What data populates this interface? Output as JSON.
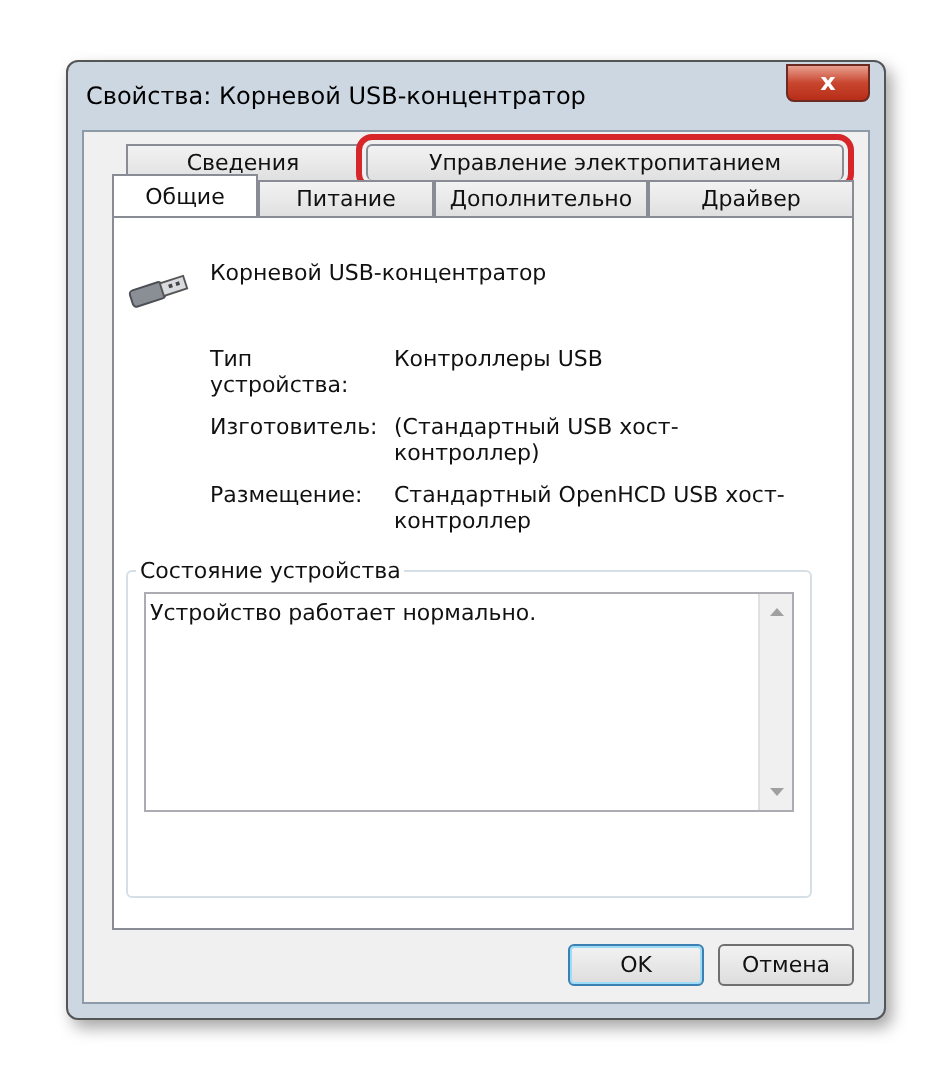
{
  "window": {
    "title": "Свойства: Корневой USB-концентратор",
    "close": "x"
  },
  "tab_rows": [
    [
      {
        "label": "Сведения",
        "selected": false,
        "highlighted": false
      },
      {
        "label": "Управление электропитанием",
        "selected": false,
        "highlighted": true
      }
    ],
    [
      {
        "label": "Общие",
        "selected": true,
        "highlighted": false
      },
      {
        "label": "Питание",
        "selected": false,
        "highlighted": false
      },
      {
        "label": "Дополнительно",
        "selected": false,
        "highlighted": false
      },
      {
        "label": "Драйвер",
        "selected": false,
        "highlighted": false
      }
    ]
  ],
  "device_name": "Корневой USB-концентратор",
  "properties": [
    {
      "label": "Тип устройства:",
      "value": "Контроллеры USB"
    },
    {
      "label": "Изготовитель:",
      "value": "(Стандартный USB хост-контроллер)"
    },
    {
      "label": "Размещение:",
      "value": "Стандартный OpenHCD USB хост-контроллер"
    }
  ],
  "status_group": {
    "title": "Состояние устройства",
    "text": "Устройство работает нормально."
  },
  "buttons": [
    {
      "label": "OK",
      "default": true
    },
    {
      "label": "Отмена",
      "default": false
    }
  ]
}
